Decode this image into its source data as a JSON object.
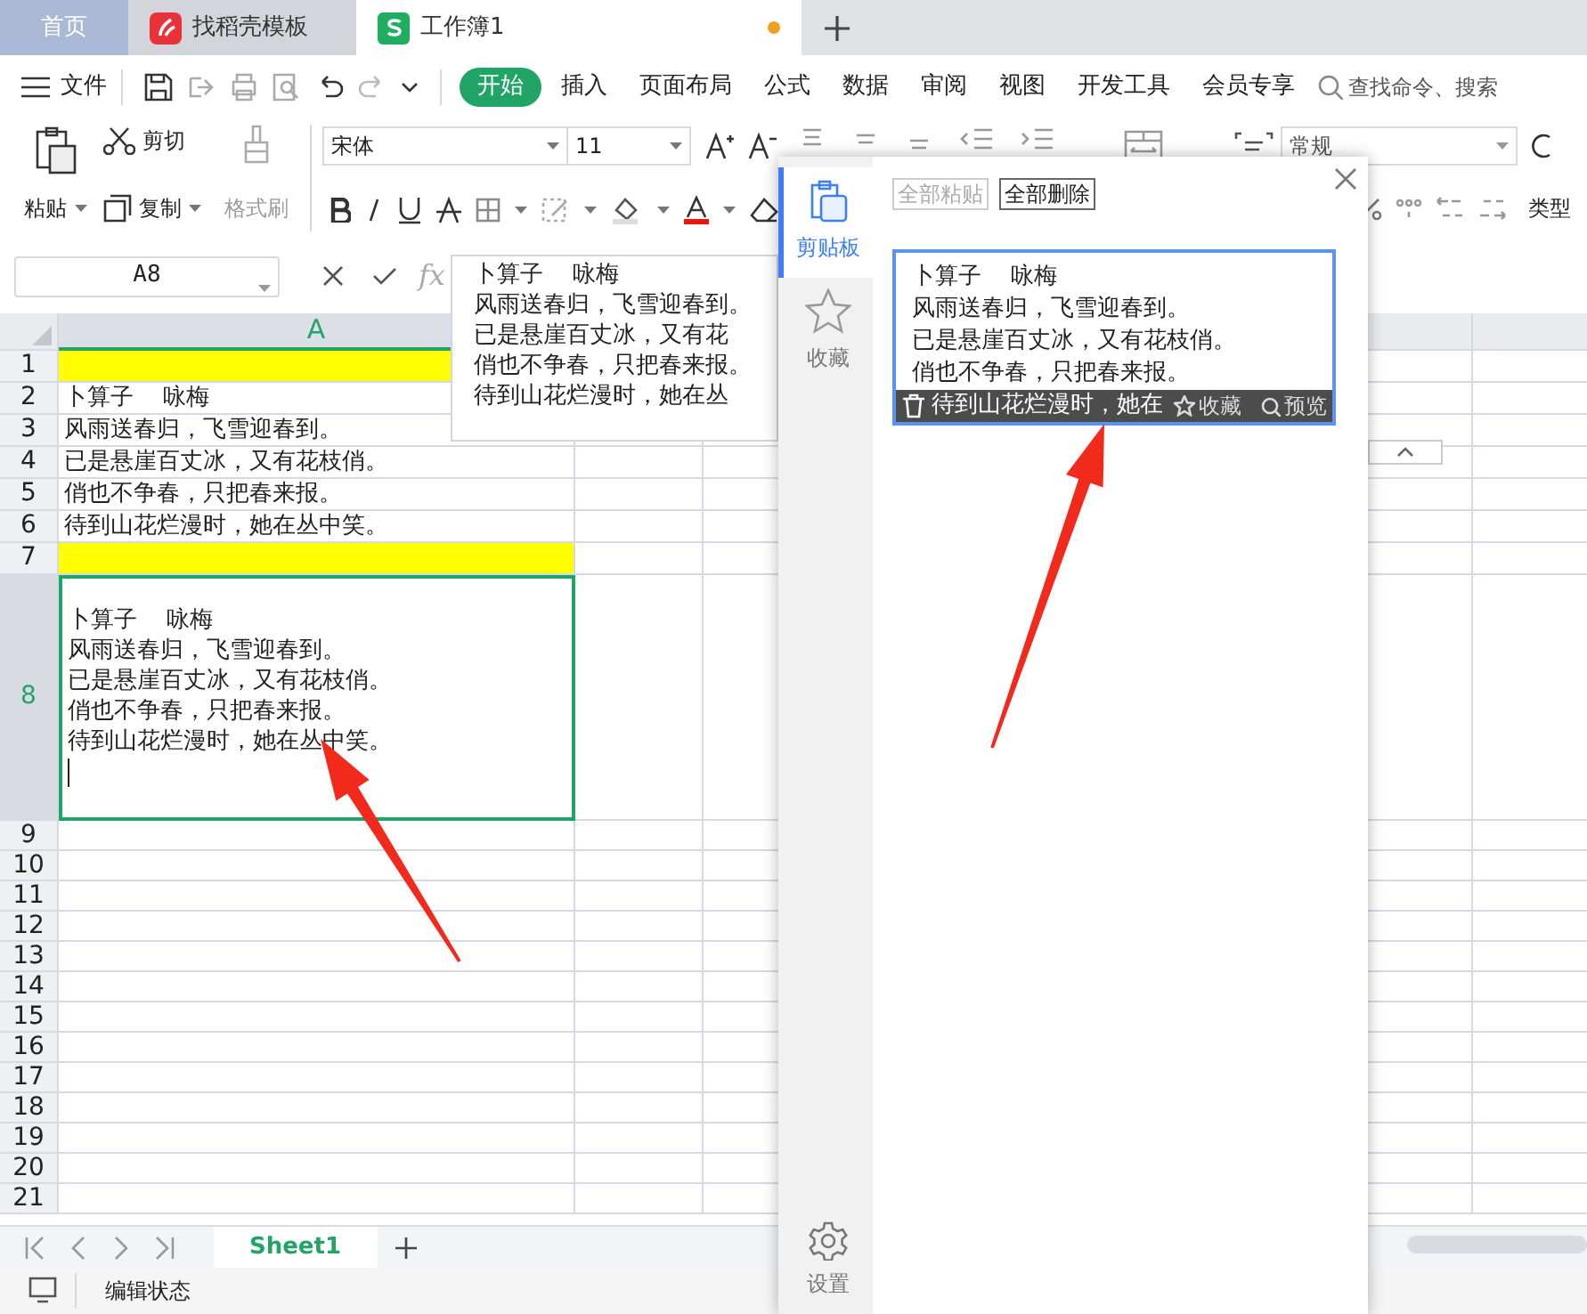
{
  "tabs": [
    {
      "label": "首页",
      "kind": "home",
      "selected": false
    },
    {
      "label": "找稻壳模板",
      "kind": "docer",
      "selected": false
    },
    {
      "label": "工作簿1",
      "kind": "sheet",
      "selected": true,
      "unsaved": true
    }
  ],
  "menu": {
    "file": "文件",
    "items": [
      {
        "label": "开始",
        "selected": true
      },
      {
        "label": "插入",
        "selected": false
      },
      {
        "label": "页面布局",
        "selected": false
      },
      {
        "label": "公式",
        "selected": false
      },
      {
        "label": "数据",
        "selected": false
      },
      {
        "label": "审阅",
        "selected": false
      },
      {
        "label": "视图",
        "selected": false
      },
      {
        "label": "开发工具",
        "selected": false
      },
      {
        "label": "会员专享",
        "selected": false
      }
    ],
    "search": {
      "placeholder": "查找命令、搜索"
    }
  },
  "ribbon": {
    "paste": "粘贴",
    "cut": "剪切",
    "copy": "复制",
    "format_painter": {
      "label": "格式刷",
      "disabled": true
    },
    "font": "宋体",
    "size": "11",
    "number_format": "常规",
    "convert": "类型"
  },
  "formula_bar": {
    "cell_ref": "A8",
    "fx": "fx",
    "popup_lines": [
      "卜算子    咏梅",
      "风雨送春归，飞雪迎春到。",
      "已是悬崖百丈冰，又有花",
      "俏也不争春，只把春来报。",
      "待到山花烂漫时，她在丛"
    ]
  },
  "sheet": {
    "column_header": "A",
    "rows": [
      {
        "header": "1",
        "highlight": true,
        "selected": false
      },
      {
        "header": "2",
        "highlight": false,
        "selected": false,
        "lines": [
          "卜算子    咏梅"
        ]
      },
      {
        "header": "3",
        "highlight": false,
        "selected": false,
        "lines": [
          "风雨送春归，飞雪迎春到。"
        ]
      },
      {
        "header": "4",
        "highlight": false,
        "selected": false,
        "lines": [
          "已是悬崖百丈冰，又有花枝俏。"
        ]
      },
      {
        "header": "5",
        "highlight": false,
        "selected": false,
        "lines": [
          "俏也不争春，只把春来报。"
        ]
      },
      {
        "header": "6",
        "highlight": false,
        "selected": false,
        "lines": [
          "待到山花烂漫时，她在丛中笑。"
        ]
      },
      {
        "header": "7",
        "highlight": true,
        "selected": false
      },
      {
        "header": "8",
        "highlight": false,
        "selected": true,
        "editing": true,
        "lines": [
          "卜算子    咏梅",
          "风雨送春归，飞雪迎春到。",
          "已是悬崖百丈冰，又有花枝俏。",
          "俏也不争春，只把春来报。",
          "待到山花烂漫时，她在丛中笑。"
        ]
      },
      {
        "header": "9",
        "highlight": false,
        "selected": false
      },
      {
        "header": "10",
        "highlight": false,
        "selected": false
      },
      {
        "header": "11",
        "highlight": false,
        "selected": false
      },
      {
        "header": "12",
        "highlight": false,
        "selected": false
      },
      {
        "header": "13",
        "highlight": false,
        "selected": false
      },
      {
        "header": "14",
        "highlight": false,
        "selected": false
      },
      {
        "header": "15",
        "highlight": false,
        "selected": false
      },
      {
        "header": "16",
        "highlight": false,
        "selected": false
      },
      {
        "header": "17",
        "highlight": false,
        "selected": false
      },
      {
        "header": "18",
        "highlight": false,
        "selected": false
      },
      {
        "header": "19",
        "highlight": false,
        "selected": false
      },
      {
        "header": "20",
        "highlight": false,
        "selected": false
      },
      {
        "header": "21",
        "highlight": false,
        "selected": false
      }
    ]
  },
  "sheet_tabs": [
    {
      "label": "Sheet1",
      "selected": true
    }
  ],
  "status_bar": {
    "mode": "编辑状态"
  },
  "clipboard_panel": {
    "nav": [
      {
        "label": "剪贴板",
        "selected": true
      },
      {
        "label": "收藏",
        "selected": false
      }
    ],
    "settings": "设置",
    "buttons": [
      {
        "label": "全部粘贴",
        "disabled": true
      },
      {
        "label": "全部删除",
        "disabled": false
      }
    ],
    "items": [
      {
        "lines": [
          "卜算子    咏梅",
          "风雨送春归，飞雪迎春到。",
          "已是悬崖百丈冰，又有花枝俏。",
          "俏也不争春，只把春来报。"
        ],
        "hover": {
          "text": "待到山花烂漫时，她在",
          "favorite": "收藏",
          "preview": "预览"
        }
      }
    ]
  }
}
